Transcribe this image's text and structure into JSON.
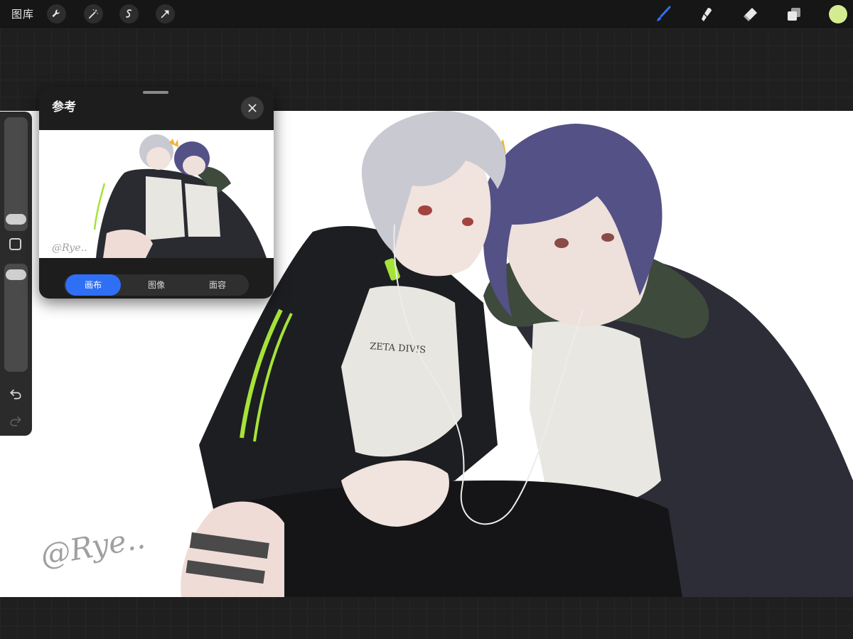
{
  "topbar": {
    "gallery_label": "图库",
    "left_tools": [
      "wrench-icon",
      "magic-wand-icon",
      "selection-s-icon",
      "arrow-transform-icon"
    ],
    "right_tools": [
      "brush-icon",
      "smudge-icon",
      "eraser-icon",
      "layers-icon"
    ],
    "active_tool": "brush-icon",
    "active_color": "#d4eb92",
    "accent_color": "#2f6ff5"
  },
  "artwork": {
    "signature": "@Rye.."
  },
  "reference_panel": {
    "title": "参考",
    "tabs": [
      {
        "label": "画布",
        "active": true
      },
      {
        "label": "图像",
        "active": false
      },
      {
        "label": "面容",
        "active": false
      }
    ]
  },
  "sidebar": {
    "brush_size_level": 0.38,
    "opacity_level": 0.05
  }
}
